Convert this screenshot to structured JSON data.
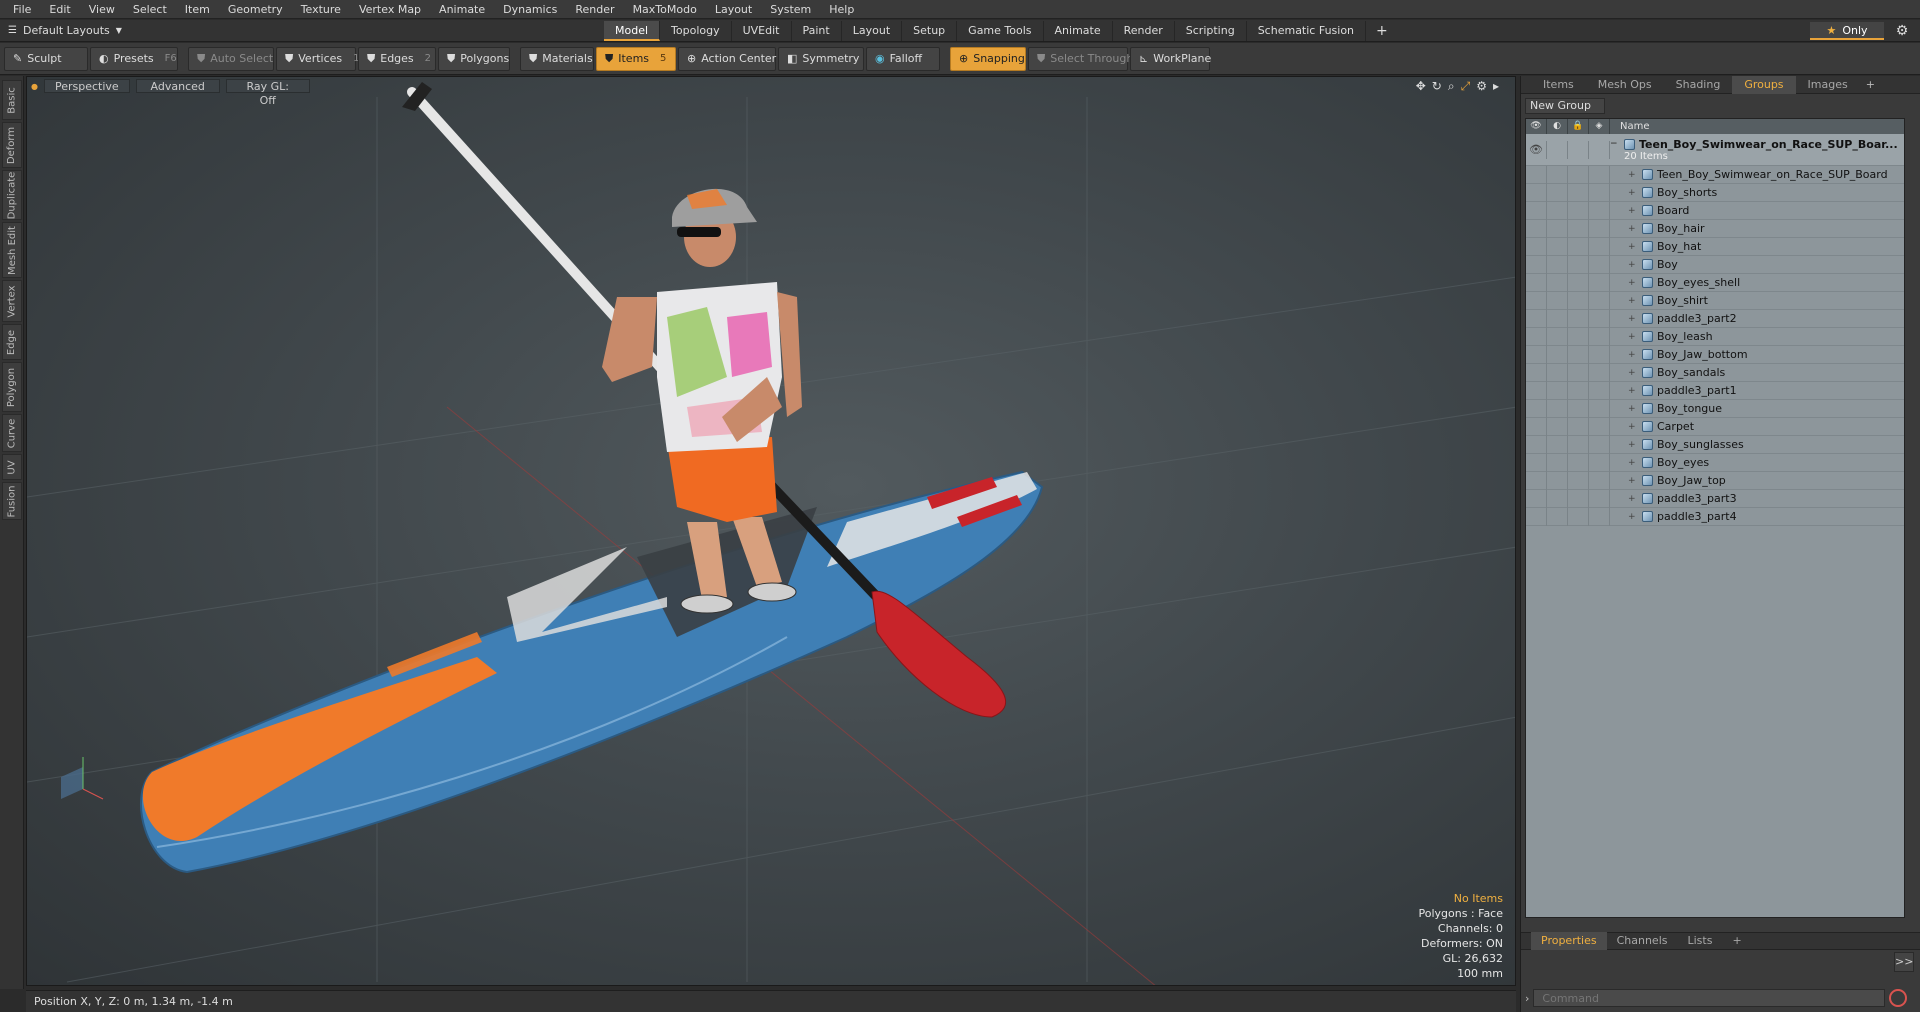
{
  "menu": [
    "File",
    "Edit",
    "View",
    "Select",
    "Item",
    "Geometry",
    "Texture",
    "Vertex Map",
    "Animate",
    "Dynamics",
    "Render",
    "MaxToModo",
    "Layout",
    "System",
    "Help"
  ],
  "layout": {
    "selector": "Default Layouts",
    "tabs": [
      "Model",
      "Topology",
      "UVEdit",
      "Paint",
      "Layout",
      "Setup",
      "Game Tools",
      "Animate",
      "Render",
      "Scripting",
      "Schematic Fusion"
    ],
    "active_tab": "Model",
    "only_label": "Only"
  },
  "toolbar": {
    "sculpt": "Sculpt",
    "presets": "Presets",
    "presets_key": "F6",
    "auto_select": "Auto Select",
    "vertices": "Vertices",
    "vertices_key": "1",
    "edges": "Edges",
    "edges_key": "2",
    "polygons": "Polygons",
    "materials": "Materials",
    "items": "Items",
    "items_key": "5",
    "action_center": "Action Center",
    "symmetry": "Symmetry",
    "falloff": "Falloff",
    "snapping": "Snapping",
    "select_through": "Select Through",
    "workplane": "WorkPlane"
  },
  "left_tabs": [
    "Basic",
    "Deform",
    "Duplicate",
    "Mesh Edit",
    "Vertex",
    "Edge",
    "Polygon",
    "Curve",
    "UV",
    "Fusion"
  ],
  "viewport": {
    "view": "Perspective",
    "mode": "Advanced",
    "raygl": "Ray GL: Off",
    "info": {
      "items": "No Items",
      "polygons": "Polygons : Face",
      "channels": "Channels: 0",
      "deformers": "Deformers: ON",
      "gl": "GL: 26,632",
      "scale": "100 mm"
    }
  },
  "status": {
    "position": "Position X, Y, Z:  0 m, 1.34 m, -1.4 m"
  },
  "right_panel": {
    "tabs": [
      "Items",
      "Mesh Ops",
      "Shading",
      "Groups",
      "Images"
    ],
    "active_tab": "Groups",
    "new_group": "New Group",
    "name_header": "Name",
    "group_name": "Teen_Boy_Swimwear_on_Race_SUP_Boar...",
    "group_count": "20 Items",
    "items": [
      "Teen_Boy_Swimwear_on_Race_SUP_Board",
      "Boy_shorts",
      "Board",
      "Boy_hair",
      "Boy_hat",
      "Boy",
      "Boy_eyes_shell",
      "Boy_shirt",
      "paddle3_part2",
      "Boy_leash",
      "Boy_Jaw_bottom",
      "Boy_sandals",
      "paddle3_part1",
      "Boy_tongue",
      "Carpet",
      "Boy_sunglasses",
      "Boy_eyes",
      "Boy_Jaw_top",
      "paddle3_part3",
      "paddle3_part4"
    ],
    "bottom_tabs": [
      "Properties",
      "Channels",
      "Lists"
    ],
    "active_bottom_tab": "Properties",
    "command_placeholder": "Command"
  },
  "colors": {
    "accent": "#e8a33a",
    "board_blue": "#3f7fb5",
    "board_orange": "#f07a2a",
    "paddle_red": "#c8242a"
  }
}
